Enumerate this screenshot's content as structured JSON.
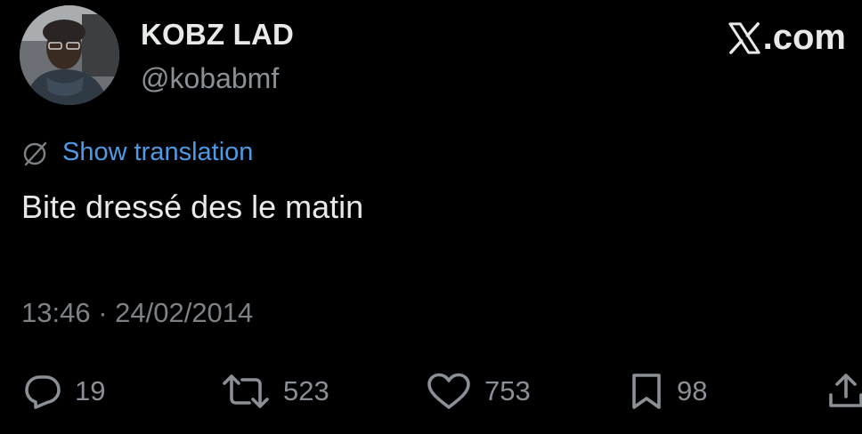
{
  "author": {
    "display_name": "KOBZ LAD",
    "handle": "@kobabmf"
  },
  "brand": {
    "label": ".com",
    "icon": "x-logo-icon"
  },
  "translation": {
    "icon": "globe-translate-icon",
    "link_label": "Show translation"
  },
  "tweet": {
    "text": "Bite dressé des le matin",
    "timestamp": "13:46 · 24/02/2014"
  },
  "actions": {
    "replies": {
      "icon": "reply-icon",
      "count": "19"
    },
    "retweets": {
      "icon": "retweet-icon",
      "count": "523"
    },
    "likes": {
      "icon": "heart-icon",
      "count": "753"
    },
    "bookmarks": {
      "icon": "bookmark-icon",
      "count": "98"
    },
    "share": {
      "icon": "share-icon"
    }
  },
  "colors": {
    "background": "#000000",
    "primary_text": "#e7e9ea",
    "secondary_text": "#8b9096",
    "link": "#4d9be6"
  }
}
